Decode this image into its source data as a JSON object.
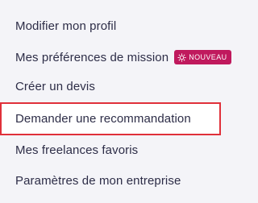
{
  "menu": {
    "items": [
      {
        "label": "Modifier mon profil"
      },
      {
        "label": "Mes préférences de mission",
        "badge": {
          "label": "NOUVEAU",
          "icon": "sparkle-icon"
        }
      },
      {
        "label": "Créer un devis"
      },
      {
        "label": "Demander une recommandation",
        "highlighted": true
      },
      {
        "label": "Mes freelances favoris"
      },
      {
        "label": "Paramètres de mon entreprise"
      }
    ]
  },
  "colors": {
    "text": "#2d2d47",
    "background": "#f4f4f8",
    "badge": "#c0195d",
    "highlight_border": "#e0303a"
  }
}
